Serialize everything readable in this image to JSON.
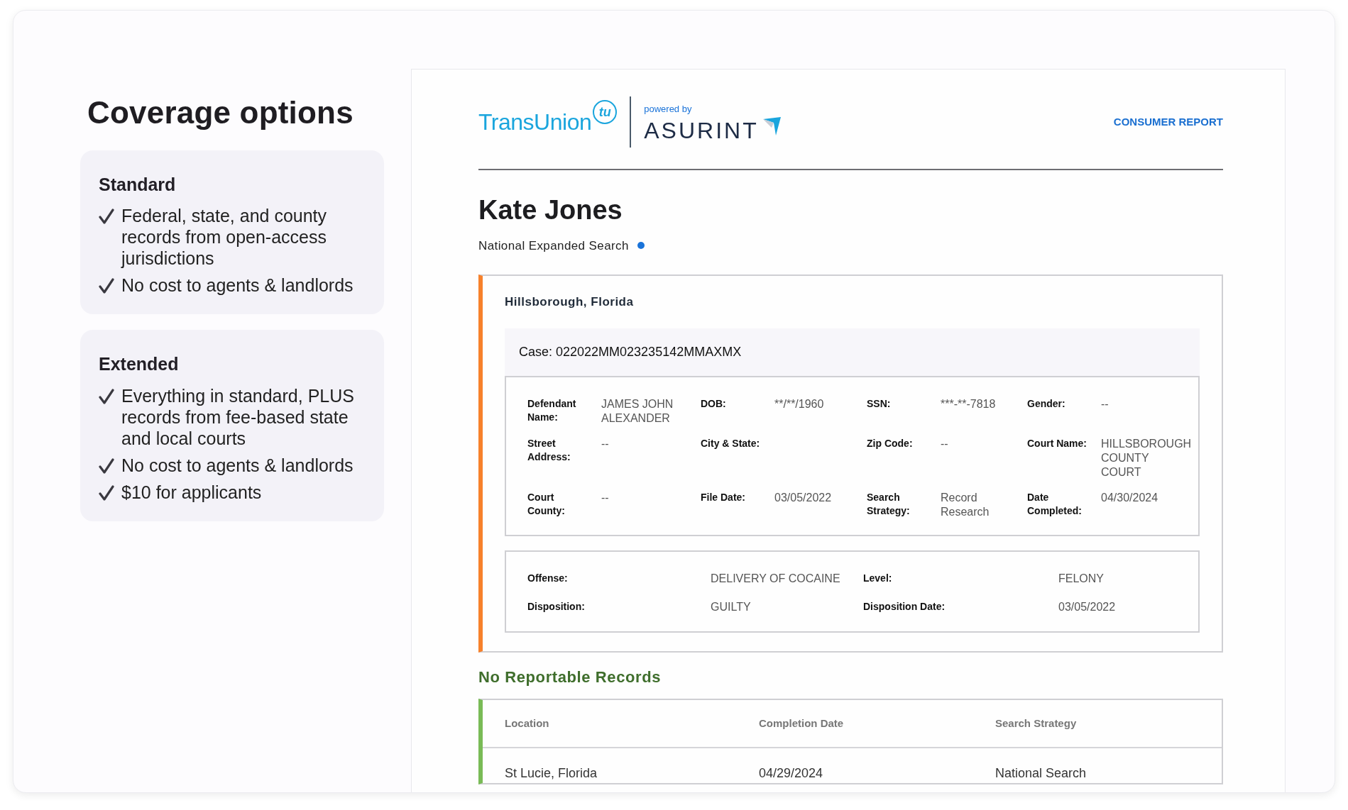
{
  "sidebar": {
    "title": "Coverage options",
    "options": [
      {
        "name": "Standard",
        "bullets": [
          "Federal, state, and county records from open-access jurisdictions",
          "No cost to agents & landlords"
        ]
      },
      {
        "name": "Extended",
        "bullets": [
          "Everything in standard, PLUS records from fee-based state and local courts",
          "No cost to agents & landlords",
          "$10 for applicants"
        ]
      }
    ]
  },
  "report": {
    "logo": {
      "brand": "TransUnion",
      "badge": "tu",
      "powered_by": "powered by",
      "partner": "ASURINT"
    },
    "report_type": "CONSUMER REPORT",
    "subject": "Kate Jones",
    "search_name": "National Expanded Search",
    "record": {
      "location": "Hillsborough, Florida",
      "case": "Case: 022022MM023235142MMAXMX",
      "details": [
        {
          "label": "Defendant Name:",
          "value": "JAMES JOHN ALEXANDER"
        },
        {
          "label": "DOB:",
          "value": "**/**/1960"
        },
        {
          "label": "SSN:",
          "value": "***-**-7818"
        },
        {
          "label": "Gender:",
          "value": "--"
        },
        {
          "label": "Street Address:",
          "value": "--"
        },
        {
          "label": "City & State:"
        },
        {
          "label": "Zip Code:",
          "value": "--"
        },
        {
          "label": "Court Name:",
          "value": "HILLSBOROUGH COUNTY COURT"
        },
        {
          "label": "Court County:",
          "value": "--"
        },
        {
          "label": "File Date:",
          "value": "03/05/2022"
        },
        {
          "label": "Search Strategy:",
          "value": "Record Research"
        },
        {
          "label": "Date Completed:",
          "value": "04/30/2024"
        }
      ],
      "offense": [
        {
          "label": "Offense:",
          "value": "DELIVERY OF COCAINE"
        },
        {
          "label": "Level:",
          "value": "FELONY"
        },
        {
          "label": "Disposition:",
          "value": "GUILTY"
        },
        {
          "label": "Disposition Date:",
          "value": "03/05/2022"
        }
      ]
    },
    "clear_section": {
      "title": "No Reportable Records",
      "columns": [
        "Location",
        "Completion Date",
        "Search Strategy"
      ],
      "rows": [
        [
          "St Lucie, Florida",
          "04/29/2024",
          "National Search"
        ]
      ]
    }
  }
}
